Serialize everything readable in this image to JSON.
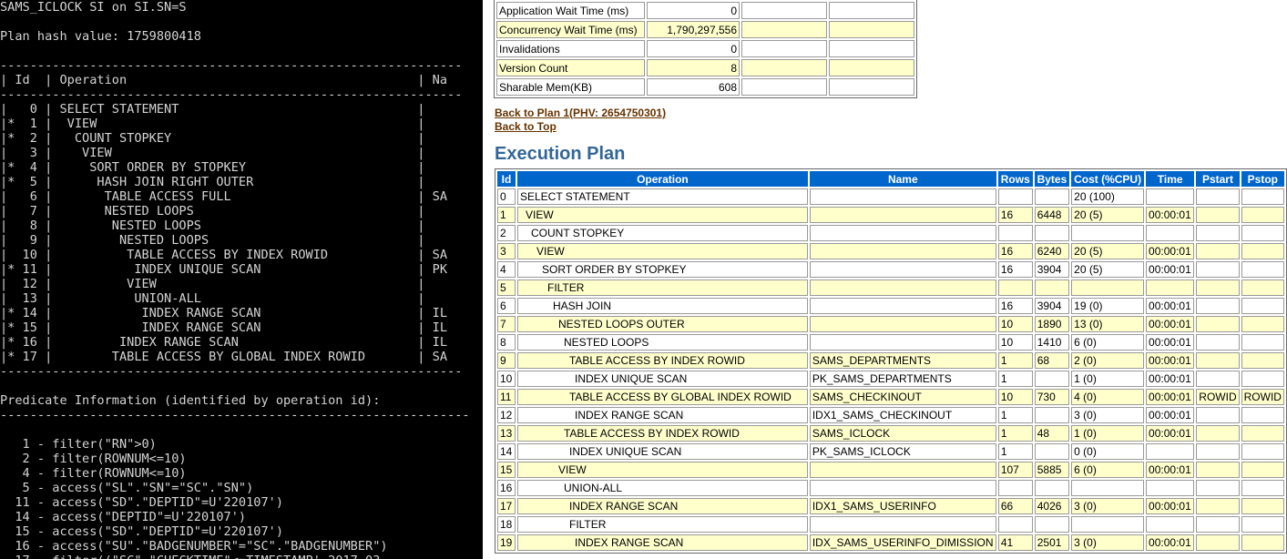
{
  "terminal": {
    "lines": [
      "SAMS_ICLOCK SI on SI.SN=S",
      "",
      "Plan hash value: 1759800418",
      "",
      "--------------------------------------------------------------",
      "| Id  | Operation                                       | Na",
      "--------------------------------------------------------------",
      "|   0 | SELECT STATEMENT                                |",
      "|*  1 |  VIEW                                           |",
      "|*  2 |   COUNT STOPKEY                                 |",
      "|   3 |    VIEW                                         |",
      "|*  4 |     SORT ORDER BY STOPKEY                       |",
      "|*  5 |      HASH JOIN RIGHT OUTER                      |",
      "|   6 |       TABLE ACCESS FULL                         | SA",
      "|   7 |       NESTED LOOPS                              |",
      "|   8 |        NESTED LOOPS                             |",
      "|   9 |         NESTED LOOPS                            |",
      "|  10 |          TABLE ACCESS BY INDEX ROWID            | SA",
      "|* 11 |           INDEX UNIQUE SCAN                     | PK",
      "|  12 |          VIEW                                   |",
      "|  13 |           UNION-ALL                             |",
      "|* 14 |            INDEX RANGE SCAN                     | IL",
      "|* 15 |            INDEX RANGE SCAN                     | IL",
      "|* 16 |         INDEX RANGE SCAN                        | IL",
      "|* 17 |        TABLE ACCESS BY GLOBAL INDEX ROWID       | SA",
      "--------------------------------------------------------------",
      "",
      "Predicate Information (identified by operation id):",
      "---------------------------------------------------------------",
      "",
      "   1 - filter(\"RN\">0)",
      "   2 - filter(ROWNUM<=10)",
      "   4 - filter(ROWNUM<=10)",
      "   5 - access(\"SL\".\"SN\"=\"SC\".\"SN\")",
      "  11 - access(\"SD\".\"DEPTID\"=U'220107')",
      "  14 - access(\"DEPTID\"=U'220107')",
      "  15 - access(\"SD\".\"DEPTID\"=U'220107')",
      "  16 - access(\"SU\".\"BADGENUMBER\"=\"SC\".\"BADGENUMBER\")",
      "  17 - filter((\"SC\".\"CHECKTIME\"<=TIMESTAMP' 2017-03-"
    ]
  },
  "stats": [
    {
      "label": "Application Wait Time (ms)",
      "value": "0"
    },
    {
      "label": "Concurrency Wait Time (ms)",
      "value": "1,790,297,556"
    },
    {
      "label": "Invalidations",
      "value": "0"
    },
    {
      "label": "Version Count",
      "value": "8"
    },
    {
      "label": "Sharable Mem(KB)",
      "value": "608"
    }
  ],
  "links": {
    "back_to_plan": "Back to Plan 1(PHV: 2654750301)",
    "back_to_top": "Back to Top"
  },
  "plan": {
    "title": "Execution Plan",
    "headers": [
      "Id",
      "Operation",
      "Name",
      "Rows",
      "Bytes",
      "Cost (%CPU)",
      "Time",
      "Pstart",
      "Pstop"
    ],
    "rows": [
      {
        "id": "0",
        "op": "SELECT STATEMENT",
        "depth": 0,
        "name": "",
        "rows": "",
        "bytes": "",
        "cost": "20 (100)",
        "time": "",
        "pstart": "",
        "pstop": ""
      },
      {
        "id": "1",
        "op": "VIEW",
        "depth": 1,
        "name": "",
        "rows": "16",
        "bytes": "6448",
        "cost": "20 (5)",
        "time": "00:00:01",
        "pstart": "",
        "pstop": ""
      },
      {
        "id": "2",
        "op": "COUNT STOPKEY",
        "depth": 2,
        "name": "",
        "rows": "",
        "bytes": "",
        "cost": "",
        "time": "",
        "pstart": "",
        "pstop": ""
      },
      {
        "id": "3",
        "op": "VIEW",
        "depth": 3,
        "name": "",
        "rows": "16",
        "bytes": "6240",
        "cost": "20 (5)",
        "time": "00:00:01",
        "pstart": "",
        "pstop": ""
      },
      {
        "id": "4",
        "op": "SORT ORDER BY STOPKEY",
        "depth": 4,
        "name": "",
        "rows": "16",
        "bytes": "3904",
        "cost": "20 (5)",
        "time": "00:00:01",
        "pstart": "",
        "pstop": ""
      },
      {
        "id": "5",
        "op": "FILTER",
        "depth": 5,
        "name": "",
        "rows": "",
        "bytes": "",
        "cost": "",
        "time": "",
        "pstart": "",
        "pstop": ""
      },
      {
        "id": "6",
        "op": "HASH JOIN",
        "depth": 6,
        "name": "",
        "rows": "16",
        "bytes": "3904",
        "cost": "19 (0)",
        "time": "00:00:01",
        "pstart": "",
        "pstop": ""
      },
      {
        "id": "7",
        "op": "NESTED LOOPS OUTER",
        "depth": 7,
        "name": "",
        "rows": "10",
        "bytes": "1890",
        "cost": "13 (0)",
        "time": "00:00:01",
        "pstart": "",
        "pstop": ""
      },
      {
        "id": "8",
        "op": "NESTED LOOPS",
        "depth": 8,
        "name": "",
        "rows": "10",
        "bytes": "1410",
        "cost": "6 (0)",
        "time": "00:00:01",
        "pstart": "",
        "pstop": ""
      },
      {
        "id": "9",
        "op": "TABLE ACCESS BY INDEX ROWID",
        "depth": 9,
        "name": "SAMS_DEPARTMENTS",
        "rows": "1",
        "bytes": "68",
        "cost": "2 (0)",
        "time": "00:00:01",
        "pstart": "",
        "pstop": ""
      },
      {
        "id": "10",
        "op": "INDEX UNIQUE SCAN",
        "depth": 10,
        "name": "PK_SAMS_DEPARTMENTS",
        "rows": "1",
        "bytes": "",
        "cost": "1 (0)",
        "time": "00:00:01",
        "pstart": "",
        "pstop": ""
      },
      {
        "id": "11",
        "op": "TABLE ACCESS BY GLOBAL INDEX ROWID",
        "depth": 9,
        "name": "SAMS_CHECKINOUT",
        "rows": "10",
        "bytes": "730",
        "cost": "4 (0)",
        "time": "00:00:01",
        "pstart": "ROWID",
        "pstop": "ROWID"
      },
      {
        "id": "12",
        "op": "INDEX RANGE SCAN",
        "depth": 10,
        "name": "IDX1_SAMS_CHECKINOUT",
        "rows": "1",
        "bytes": "",
        "cost": "3 (0)",
        "time": "00:00:01",
        "pstart": "",
        "pstop": ""
      },
      {
        "id": "13",
        "op": "TABLE ACCESS BY INDEX ROWID",
        "depth": 8,
        "name": "SAMS_ICLOCK",
        "rows": "1",
        "bytes": "48",
        "cost": "1 (0)",
        "time": "00:00:01",
        "pstart": "",
        "pstop": ""
      },
      {
        "id": "14",
        "op": "INDEX UNIQUE SCAN",
        "depth": 9,
        "name": "PK_SAMS_ICLOCK",
        "rows": "1",
        "bytes": "",
        "cost": "0 (0)",
        "time": "",
        "pstart": "",
        "pstop": ""
      },
      {
        "id": "15",
        "op": "VIEW",
        "depth": 7,
        "name": "",
        "rows": "107",
        "bytes": "5885",
        "cost": "6 (0)",
        "time": "00:00:01",
        "pstart": "",
        "pstop": ""
      },
      {
        "id": "16",
        "op": "UNION-ALL",
        "depth": 8,
        "name": "",
        "rows": "",
        "bytes": "",
        "cost": "",
        "time": "",
        "pstart": "",
        "pstop": ""
      },
      {
        "id": "17",
        "op": "INDEX RANGE SCAN",
        "depth": 9,
        "name": "IDX1_SAMS_USERINFO",
        "rows": "66",
        "bytes": "4026",
        "cost": "3 (0)",
        "time": "00:00:01",
        "pstart": "",
        "pstop": ""
      },
      {
        "id": "18",
        "op": "FILTER",
        "depth": 9,
        "name": "",
        "rows": "",
        "bytes": "",
        "cost": "",
        "time": "",
        "pstart": "",
        "pstop": ""
      },
      {
        "id": "19",
        "op": "INDEX RANGE SCAN",
        "depth": 10,
        "name": "IDX_SAMS_USERINFO_DIMISSION",
        "rows": "41",
        "bytes": "2501",
        "cost": "3 (0)",
        "time": "00:00:01",
        "pstart": "",
        "pstop": ""
      }
    ]
  }
}
